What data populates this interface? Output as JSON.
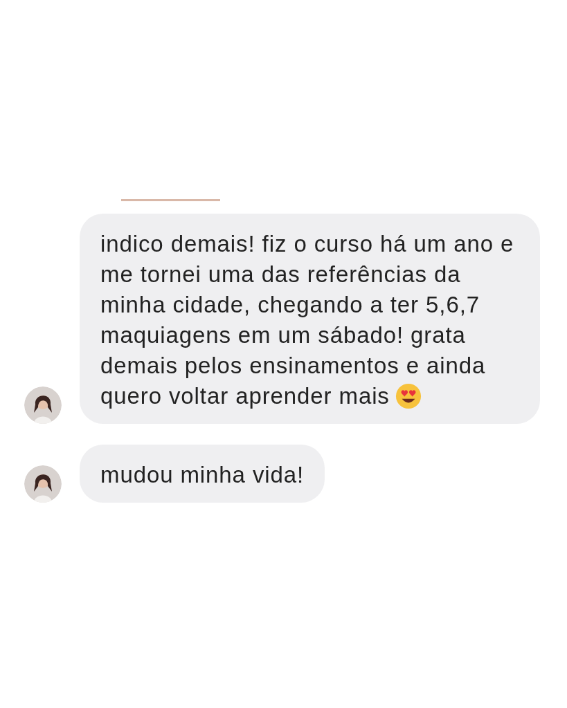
{
  "messages": [
    {
      "text": "indico demais! fiz o curso há um ano e me tornei uma das referências da minha cidade, chegando a ter 5,6,7 maquiagens em um sábado! grata demais pelos ensinamentos e ainda quero voltar aprender mais",
      "trailing_emoji": true
    },
    {
      "text": "mudou minha vida!"
    }
  ]
}
